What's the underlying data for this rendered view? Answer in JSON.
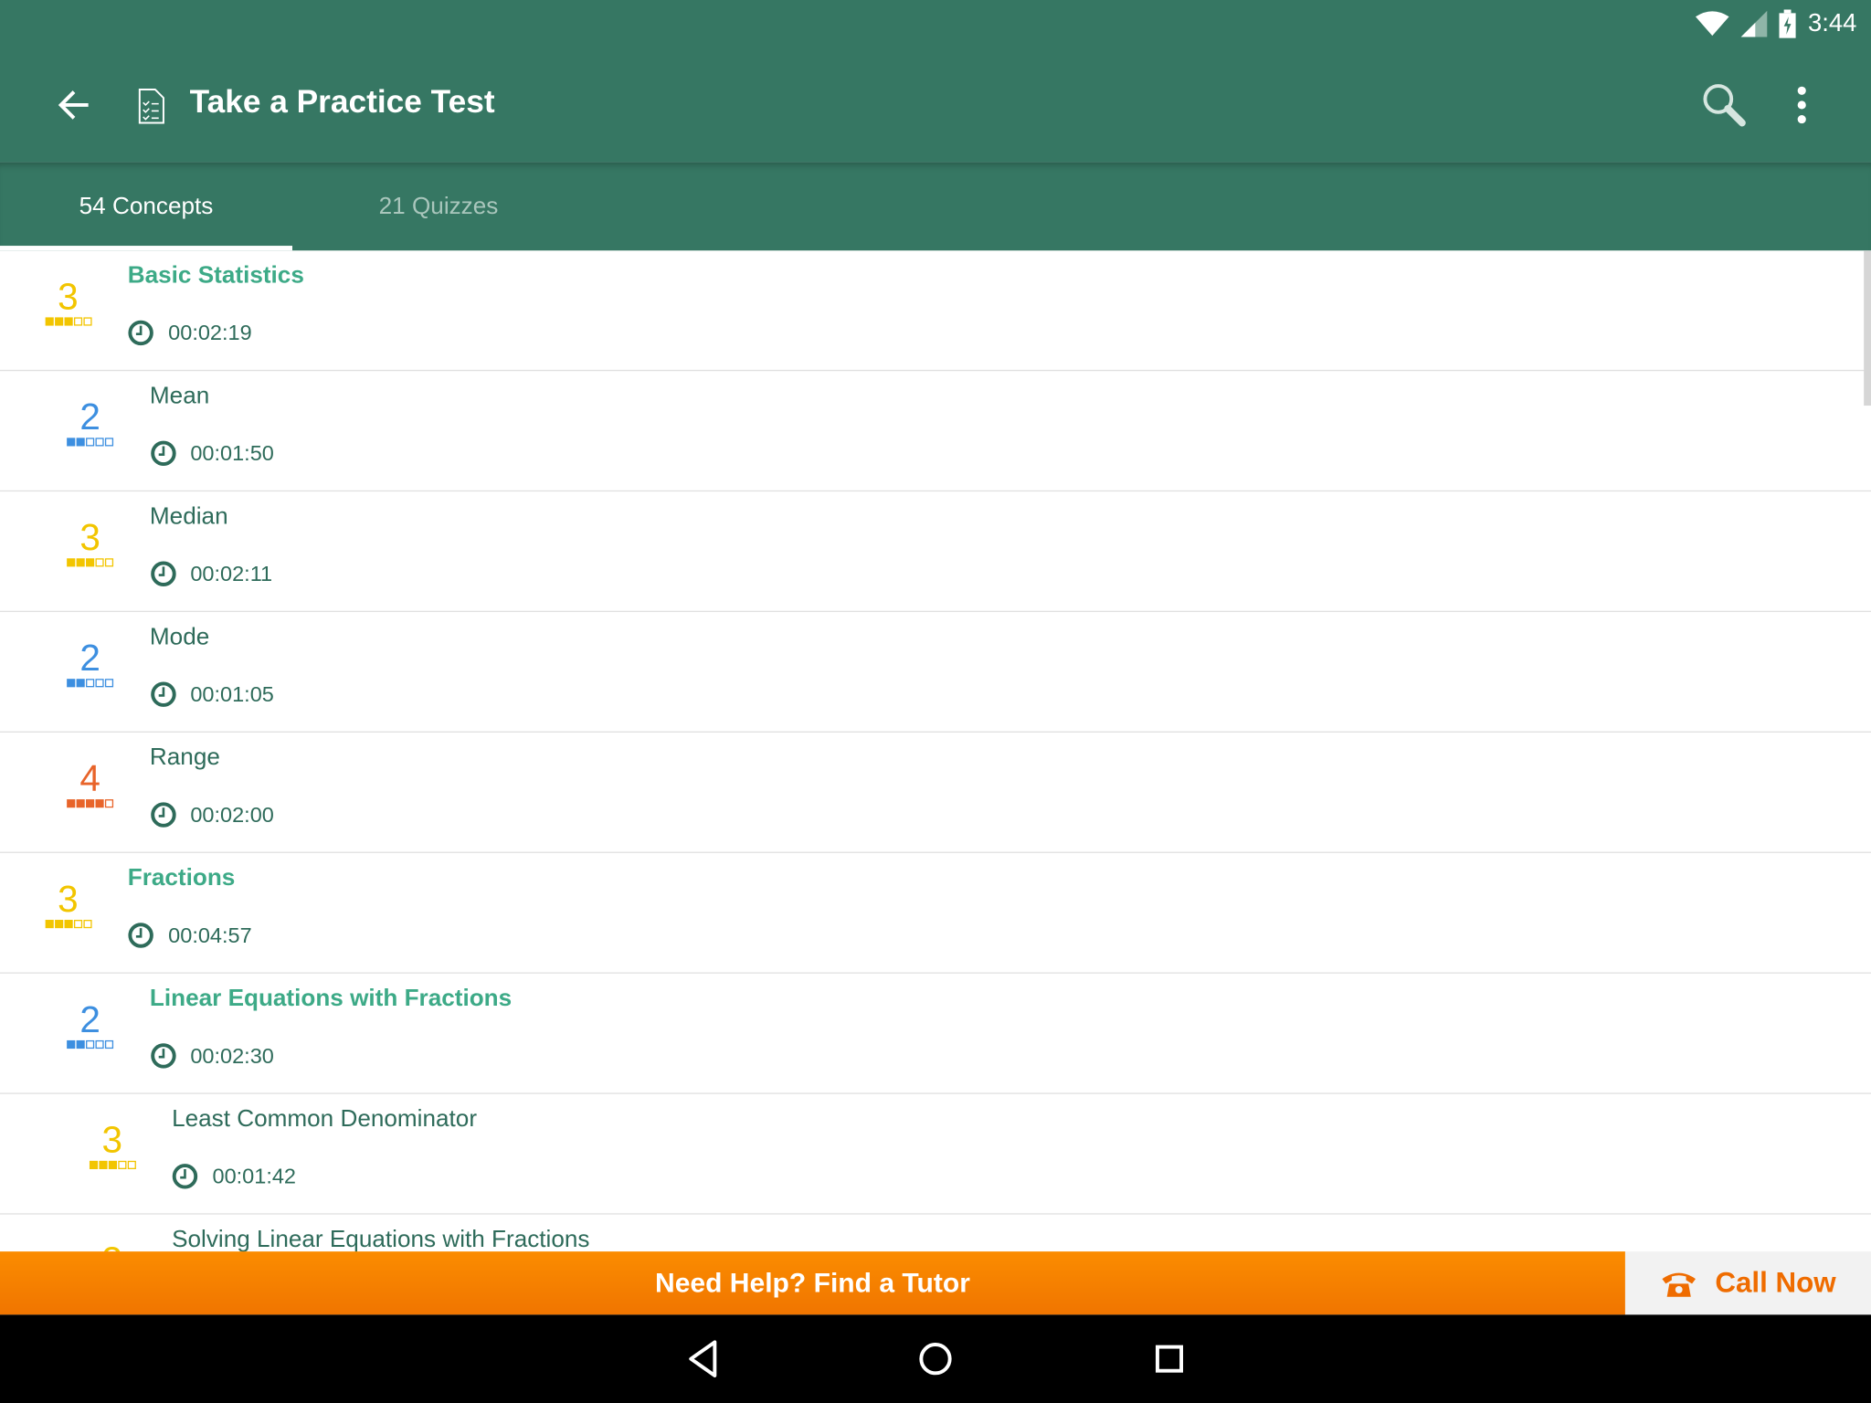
{
  "status_bar": {
    "time": "3:44",
    "icons": [
      "wifi-icon",
      "signal-icon",
      "battery-charging-icon"
    ]
  },
  "app_bar": {
    "title": "Take a Practice Test",
    "icons": [
      "back-arrow-icon",
      "checklist-document-icon",
      "search-icon",
      "more-vert-icon"
    ]
  },
  "tabs": [
    {
      "label": "54 Concepts",
      "active": true
    },
    {
      "label": "21 Quizzes",
      "active": false
    }
  ],
  "colors": {
    "primary": "#367763",
    "group_title": "#3daa87",
    "text": "#2e6b5a",
    "level_2": "#3d8fe0",
    "level_3": "#f2c500",
    "level_4": "#e8642a",
    "banner": "#fb8c00"
  },
  "concepts": [
    {
      "name": "Basic Statistics",
      "time": "00:02:19",
      "level": "3",
      "depth": 0,
      "group": true
    },
    {
      "name": "Mean",
      "time": "00:01:50",
      "level": "2",
      "depth": 1,
      "group": false
    },
    {
      "name": "Median",
      "time": "00:02:11",
      "level": "3",
      "depth": 1,
      "group": false
    },
    {
      "name": "Mode",
      "time": "00:01:05",
      "level": "2",
      "depth": 1,
      "group": false
    },
    {
      "name": "Range",
      "time": "00:02:00",
      "level": "4",
      "depth": 1,
      "group": false
    },
    {
      "name": "Fractions",
      "time": "00:04:57",
      "level": "3",
      "depth": 0,
      "group": true
    },
    {
      "name": "Linear Equations with Fractions",
      "time": "00:02:30",
      "level": "2",
      "depth": 1,
      "group": true
    },
    {
      "name": "Least Common Denominator",
      "time": "00:01:42",
      "level": "3",
      "depth": 2,
      "group": false
    },
    {
      "name": "Solving Linear Equations with Fractions",
      "time": null,
      "level": "3",
      "depth": 2,
      "group": false
    }
  ],
  "banner": {
    "label": "Need Help? Find a Tutor",
    "call_label": "Call Now",
    "call_icon": "phone-icon"
  },
  "nav_bar": {
    "icons": [
      "back-triangle-icon",
      "home-circle-icon",
      "recents-square-icon"
    ]
  }
}
